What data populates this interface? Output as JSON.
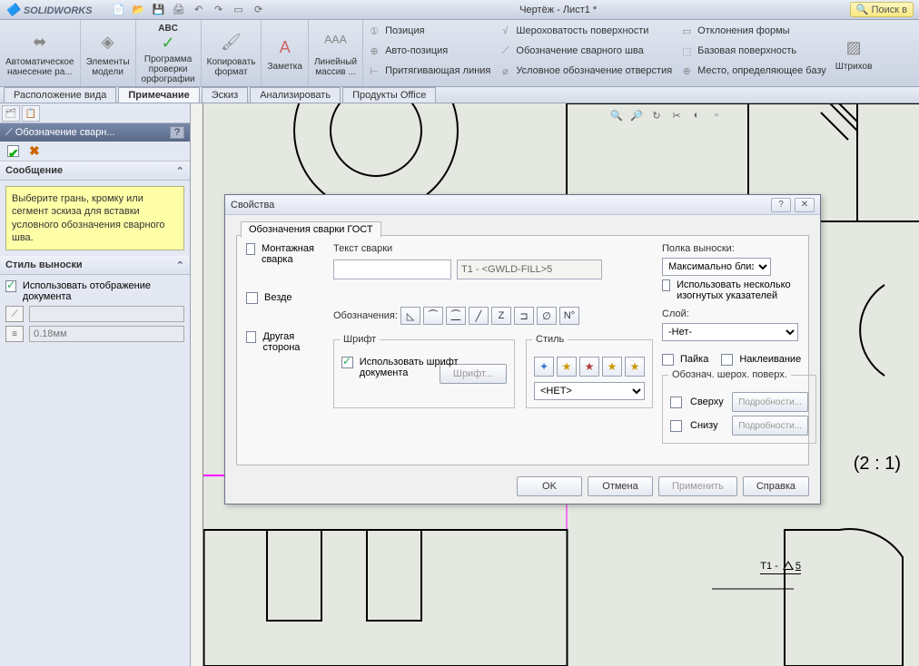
{
  "app": {
    "logo_text": "SOLIDWORKS",
    "doc_title": "Чертёж - Лист1 *",
    "search_placeholder": "Поиск в"
  },
  "ribbon": {
    "g1": "Автоматическое\nнанесение ра...",
    "g2": "Элементы\nмодели",
    "g3": "Программа\nпроверки\nорфографии",
    "g3_abc": "ABC",
    "g4": "Копировать\nформат",
    "g5": "Заметка",
    "g6": "Линейный\nмассив ...",
    "col1": {
      "a": "Позиция",
      "b": "Авто-позиция",
      "c": "Притягивающая линия"
    },
    "col2": {
      "a": "Шероховатость поверхности",
      "b": "Обозначение сварного шва",
      "c": "Условное обозначение отверстия"
    },
    "col3": {
      "a": "Отклонения формы",
      "b": "Базовая поверхность",
      "c": "Место, определяющее базу"
    },
    "g_last": "Штрихов"
  },
  "subtabs": {
    "t1": "Расположение вида",
    "t2": "Примечание",
    "t3": "Эскиз",
    "t4": "Анализировать",
    "t5": "Продукты Office"
  },
  "pm": {
    "title": "Обозначение сварн...",
    "sec_msg": "Сообщение",
    "msg": "Выберите грань, кромку или сегмент эскиза для вставки условного обозначения сварного шва.",
    "sec_style": "Стиль выноски",
    "use_doc_display": "Использовать отображение документа",
    "dim_placeholder": "0.18мм"
  },
  "dlg": {
    "title": "Свойства",
    "tab": "Обозначения сварки ГОСТ",
    "left": {
      "montazh": "Монтажная сварка",
      "vezde": "Везде",
      "other": "Другая сторона"
    },
    "mid": {
      "text_label": "Текст сварки",
      "text_value": "T1 - <GWLD-FILL>5",
      "sym_label": "Обозначения:",
      "font_group": "Шрифт",
      "use_doc_font": "Использовать шрифт документа",
      "font_btn": "Шрифт...",
      "style_group": "Стиль",
      "style_none": "<НЕТ>"
    },
    "right": {
      "lbl_leader": "Полка выноски:",
      "leader_val": "Максимально близ",
      "multi_bent": "Использовать несколько изогнутых указателей",
      "lbl_layer": "Слой:",
      "layer_val": "-Нет-",
      "solder": "Пайка",
      "glue": "Наклеивание",
      "surf_group": "Обознач. шерох. поверх.",
      "top": "Сверху",
      "bottom": "Снизу",
      "details": "Подробности..."
    },
    "footer": {
      "ok": "OK",
      "cancel": "Отмена",
      "apply": "Применить",
      "help": "Справка"
    }
  },
  "canvas": {
    "scale": "(2 : 1)",
    "weld": {
      "prefix": "T1 - ",
      "suffix": "5"
    }
  }
}
